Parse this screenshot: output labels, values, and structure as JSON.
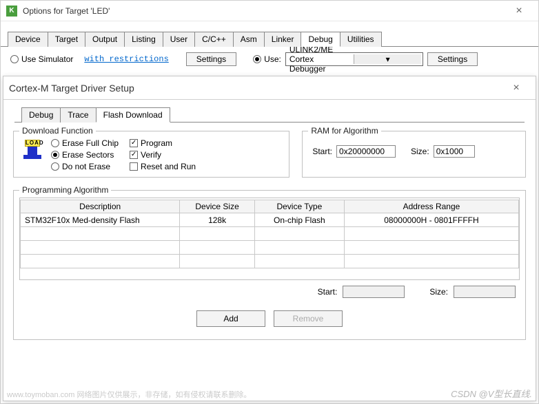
{
  "parent": {
    "title": "Options for Target 'LED'",
    "tabs": [
      "Device",
      "Target",
      "Output",
      "Listing",
      "User",
      "C/C++",
      "Asm",
      "Linker",
      "Debug",
      "Utilities"
    ],
    "active_tab": "Debug",
    "sim_label": "Use Simulator",
    "restrictions": "with restrictions",
    "settings_btn": "Settings",
    "use_label": "Use:",
    "debugger": "ULINK2/ME Cortex Debugger"
  },
  "dialog": {
    "title": "Cortex-M Target Driver Setup",
    "tabs": [
      "Debug",
      "Trace",
      "Flash Download"
    ],
    "active_tab": "Flash Download",
    "download_fn": {
      "legend": "Download Function",
      "erase_full": "Erase Full Chip",
      "erase_sectors": "Erase Sectors",
      "do_not_erase": "Do not Erase",
      "program": "Program",
      "verify": "Verify",
      "reset_run": "Reset and Run"
    },
    "ram": {
      "legend": "RAM for Algorithm",
      "start_label": "Start:",
      "start": "0x20000000",
      "size_label": "Size:",
      "size": "0x1000"
    },
    "prog_algo": {
      "legend": "Programming Algorithm",
      "cols": [
        "Description",
        "Device Size",
        "Device Type",
        "Address Range"
      ],
      "rows": [
        {
          "desc": "STM32F10x Med-density Flash",
          "size": "128k",
          "type": "On-chip Flash",
          "range": "08000000H - 0801FFFFH"
        }
      ],
      "start_label": "Start:",
      "start": "",
      "size_label": "Size:",
      "size": "",
      "add": "Add",
      "remove": "Remove"
    }
  },
  "watermark": "CSDN @V型长直线.",
  "watermark2": "www.toymoban.com  网络图片仅供展示，非存储，如有侵权请联系删除。"
}
